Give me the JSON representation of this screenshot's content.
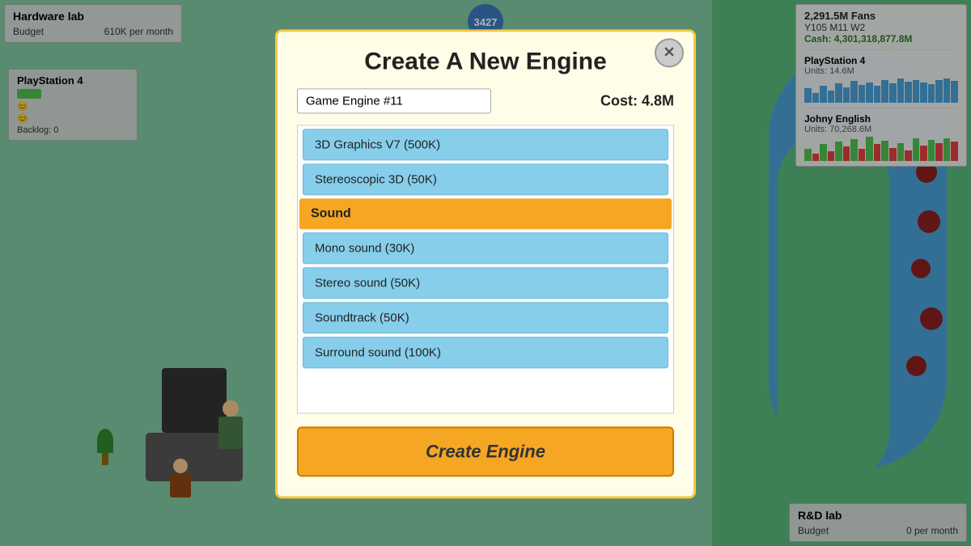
{
  "game": {
    "badge_count": "3427",
    "fans": "2,291.5M Fans",
    "date": "Y105 M11 W2",
    "cash_label": "Cash:",
    "cash_value": "4,301,318,877.8M"
  },
  "hw_lab": {
    "title": "Hardware lab",
    "budget_label": "Budget",
    "budget_value": "610K per month"
  },
  "ps4_left": {
    "title": "PlayStation 4",
    "backlog": "Backlog: 0"
  },
  "stats_ps4": {
    "title": "PlayStation 4",
    "units_label": "Units:",
    "units_value": "14.6M"
  },
  "stats_johny": {
    "title": "Johny English",
    "units_label": "Units:",
    "units_value": "70,268.6M"
  },
  "rd_lab": {
    "title": "R&D lab",
    "budget_label": "Budget",
    "budget_value": "0 per month"
  },
  "modal": {
    "title": "Create A New Engine",
    "close_btn": "✕",
    "engine_name": "Game Engine #11",
    "cost_label": "Cost:",
    "cost_value": "4.8M",
    "create_btn": "Create Engine",
    "features": [
      {
        "type": "item",
        "label": "3D Graphics V7 (500K)"
      },
      {
        "type": "item",
        "label": "Stereoscopic 3D (50K)"
      },
      {
        "type": "category",
        "label": "Sound"
      },
      {
        "type": "item",
        "label": "Mono sound (30K)"
      },
      {
        "type": "item",
        "label": "Stereo sound (50K)"
      },
      {
        "type": "item",
        "label": "Soundtrack (50K)"
      },
      {
        "type": "item",
        "label": "Surround sound (100K)"
      }
    ]
  }
}
